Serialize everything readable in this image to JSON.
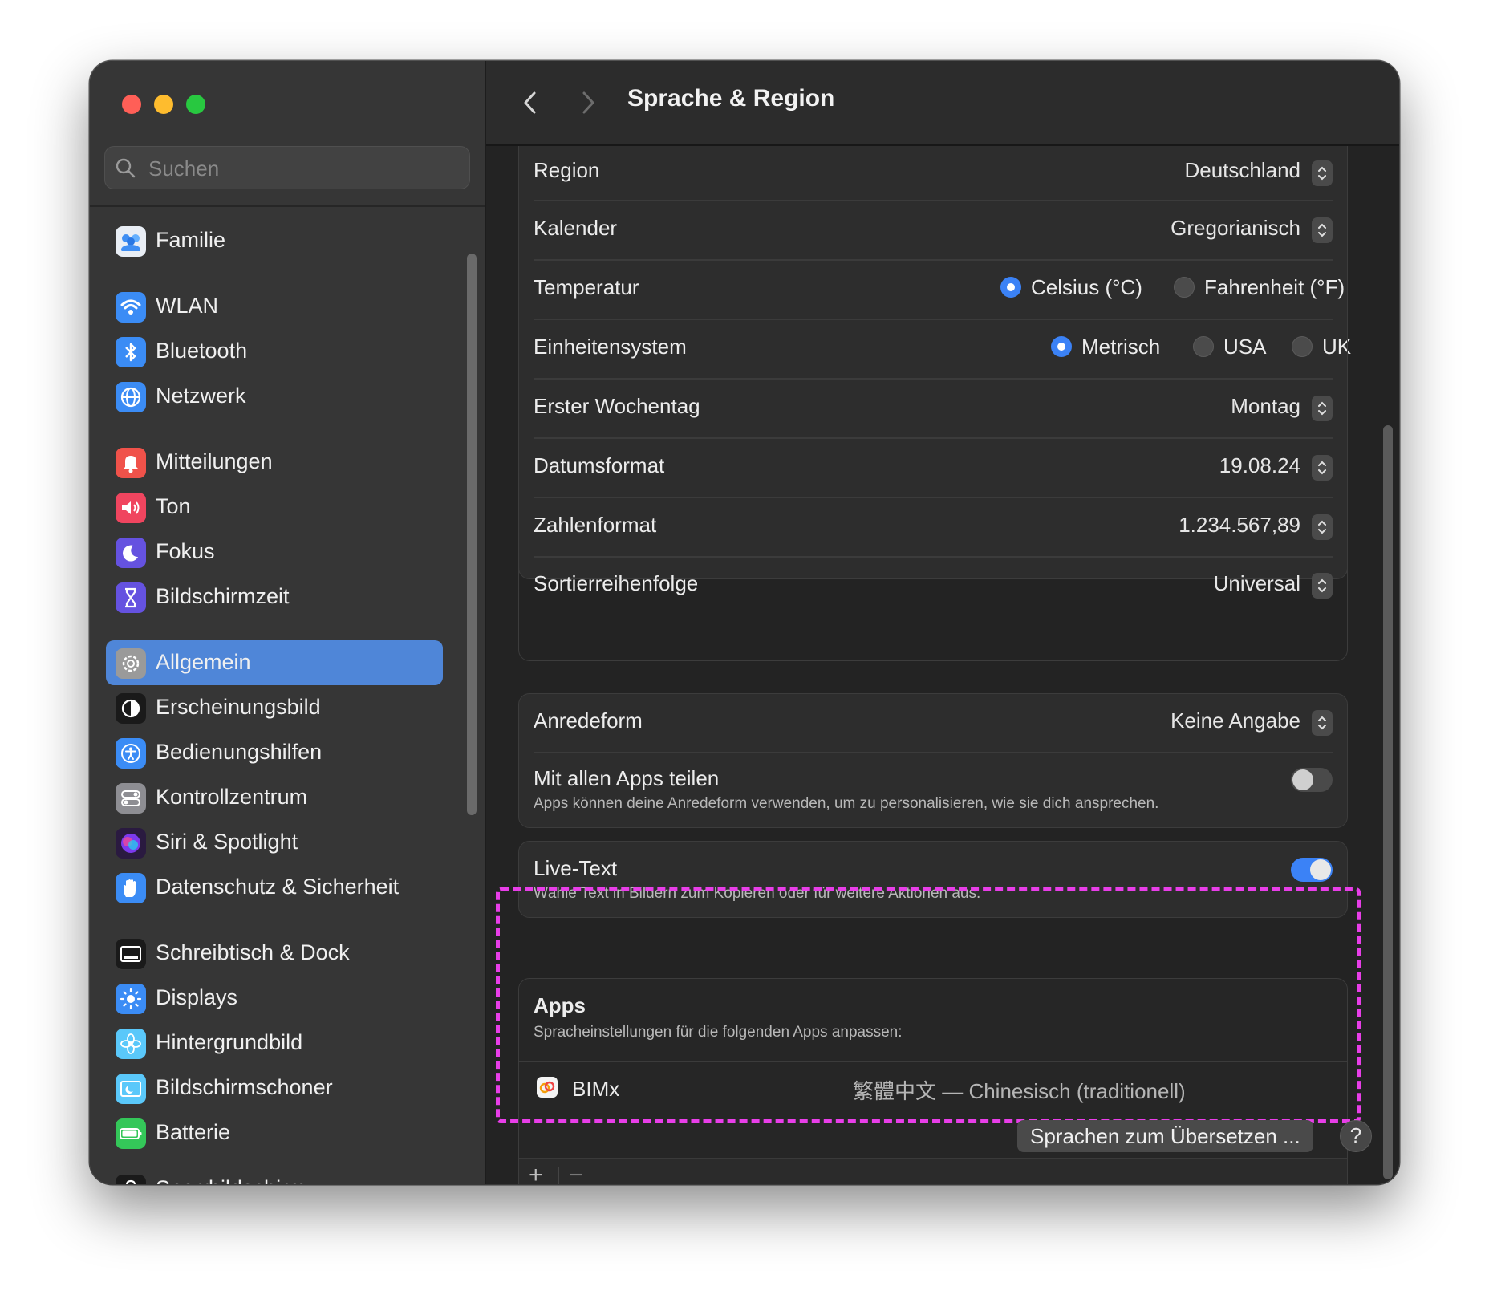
{
  "window": {
    "title": "Sprache & Region"
  },
  "sidebar": {
    "search_placeholder": "Suchen",
    "items": [
      {
        "label": "Familie",
        "icon": "family-icon",
        "color": "#e9eef5"
      },
      {
        "label": "WLAN",
        "icon": "wifi-icon",
        "color": "#3b8cf5"
      },
      {
        "label": "Bluetooth",
        "icon": "bluetooth-icon",
        "color": "#3b8cf5"
      },
      {
        "label": "Netzwerk",
        "icon": "globe-icon",
        "color": "#3b8cf5"
      },
      {
        "label": "Mitteilungen",
        "icon": "bell-icon",
        "color": "#f0524a"
      },
      {
        "label": "Ton",
        "icon": "speaker-icon",
        "color": "#f0455f"
      },
      {
        "label": "Fokus",
        "icon": "moon-icon",
        "color": "#6552e0"
      },
      {
        "label": "Bildschirmzeit",
        "icon": "hourglass-icon",
        "color": "#6552e0"
      },
      {
        "label": "Allgemein",
        "icon": "gear-icon",
        "color": "#9a9a9a",
        "selected": true
      },
      {
        "label": "Erscheinungsbild",
        "icon": "appearance-icon",
        "color": "#1a1a1a"
      },
      {
        "label": "Bedienungshilfen",
        "icon": "accessibility-icon",
        "color": "#3b8cf5"
      },
      {
        "label": "Kontrollzentrum",
        "icon": "toggles-icon",
        "color": "#8e8e93"
      },
      {
        "label": "Siri & Spotlight",
        "icon": "siri-icon",
        "color": "#8a3fd1"
      },
      {
        "label": "Datenschutz & Sicherheit",
        "icon": "hand-icon",
        "color": "#3b8cf5"
      },
      {
        "label": "Schreibtisch & Dock",
        "icon": "dock-icon",
        "color": "#1a1a1a"
      },
      {
        "label": "Displays",
        "icon": "sun-icon",
        "color": "#3b8cf5"
      },
      {
        "label": "Hintergrundbild",
        "icon": "flower-icon",
        "color": "#5ac8fa"
      },
      {
        "label": "Bildschirmschoner",
        "icon": "screensaver-icon",
        "color": "#5ac8fa"
      },
      {
        "label": "Batterie",
        "icon": "battery-icon",
        "color": "#34c759"
      },
      {
        "label": "Sperrbildschirm",
        "icon": "lock-icon",
        "color": "#1a1a1a"
      }
    ]
  },
  "main": {
    "region": {
      "label": "Region",
      "value": "Deutschland"
    },
    "calendar": {
      "label": "Kalender",
      "value": "Gregorianisch"
    },
    "temperature": {
      "label": "Temperatur",
      "options": [
        "Celsius (°C)",
        "Fahrenheit (°F)"
      ],
      "selected": "Celsius (°C)"
    },
    "units": {
      "label": "Einheitensystem",
      "options": [
        "Metrisch",
        "USA",
        "UK"
      ],
      "selected": "Metrisch"
    },
    "first_weekday": {
      "label": "Erster Wochentag",
      "value": "Montag"
    },
    "date_format": {
      "label": "Datumsformat",
      "value": "19.08.24"
    },
    "number_format": {
      "label": "Zahlenformat",
      "value": "1.234.567,89"
    },
    "sort_order": {
      "label": "Sortierreihenfolge",
      "value": "Universal"
    },
    "address_form": {
      "label": "Anredeform",
      "value": "Keine Angabe"
    },
    "share_all_apps": {
      "label": "Mit allen Apps teilen",
      "description": "Apps können deine Anredeform verwenden, um zu personalisieren, wie sie dich ansprechen.",
      "enabled": false
    },
    "live_text": {
      "label": "Live-Text",
      "description": "Wähle Text in Bildern zum Kopieren oder für weitere Aktionen aus.",
      "enabled": true
    },
    "apps": {
      "title": "Apps",
      "subtitle": "Spracheinstellungen für die folgenden Apps anpassen:",
      "list": [
        {
          "name": "BIMx",
          "language": "繁體中文 — Chinesisch (traditionell)"
        }
      ],
      "add_label": "+",
      "remove_label": "−"
    },
    "translate_button": "Sprachen zum Übersetzen ...",
    "help_button": "?"
  },
  "colors": {
    "accent": "#3b82f6",
    "highlight": "#e83ee8",
    "selected_sidebar": "#4f86d8"
  }
}
